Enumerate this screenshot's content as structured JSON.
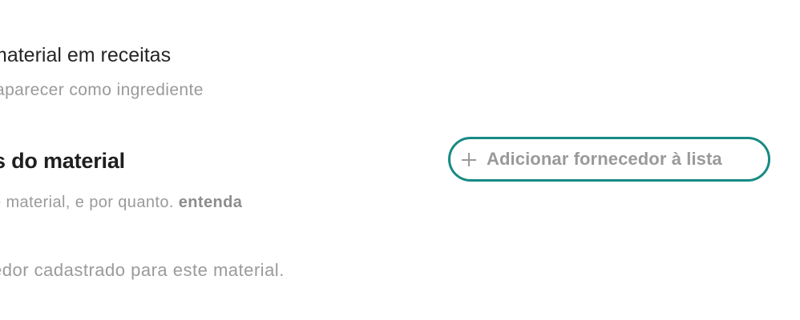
{
  "recipes": {
    "title": "material em receitas",
    "subtitle": "aparecer como ingrediente"
  },
  "suppliers": {
    "title": "s do material",
    "description": "e material, e por quanto.",
    "learn_link": "entenda",
    "empty_state": "edor cadastrado para este material.",
    "add_button_label": "Adicionar fornecedor à lista",
    "add_button_icon": "plus-icon"
  },
  "colors": {
    "accent": "#178a84",
    "text_primary": "#1f1f1f",
    "text_muted": "#9a9a9a"
  }
}
